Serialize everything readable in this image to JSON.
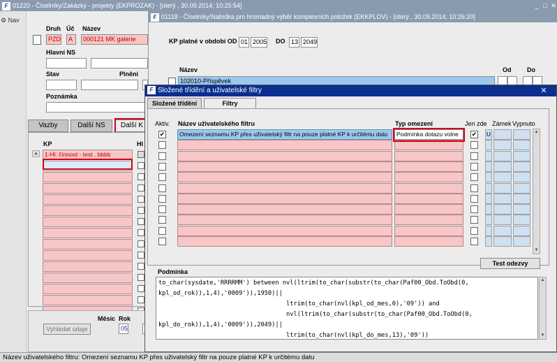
{
  "colors": {
    "title_active": "#0a2f8f",
    "title_inactive": "#8a9bb0",
    "pink": "#f7c6c6",
    "highlight_red": "#d4001a",
    "selected_row": "#9cc8f0"
  },
  "win1": {
    "title": "01220 - Číselníky/Zakázky - projekty (EKPROZAK) - [úterý , 30.09.2014; 10:25:54]",
    "nav": "Nav",
    "labels": {
      "druh": "Druh",
      "uc": "Úč",
      "nazev": "Název",
      "hlavni_ns": "Hlavní NS",
      "stav": "Stav",
      "plneni": "Plnění",
      "poznamka": "Poznámka",
      "kp": "KP",
      "hl": "Hl",
      "mesic": "Měsíc",
      "rok": "Rok"
    },
    "values": {
      "druh": "PZD",
      "uc": "A",
      "nazev": "000121 MK galerie",
      "mesic": "05"
    },
    "tabs": [
      "Vazby",
      "Další NS",
      "Další K"
    ],
    "kp_rows": [
      "1-Hl. činnost - test . bbbb",
      "",
      "",
      "",
      "",
      "",
      "",
      "",
      "",
      "",
      "",
      "",
      "",
      "",
      ""
    ],
    "button": "Vyhledat údaje"
  },
  "win2": {
    "title": "01118 - Číselníky/Nabídka pro hromadný výběr komplexních položek (EKKPLOV) - [úterý , 30.09.2014; 10:26:20]",
    "period_label": "KP platné v období OD",
    "od": [
      "01",
      "2005"
    ],
    "do_label": "DO",
    "do": [
      "13",
      "2049"
    ],
    "nazev_header": "Název",
    "od_header": "Od",
    "do_header": "Do",
    "first_row": "102010-Příspěvek"
  },
  "win3": {
    "title": "Složené třídění a uživatelské filtry",
    "tabs": [
      "Složené třídění",
      "Filtry"
    ],
    "headers": {
      "aktiv": "Aktiv.",
      "nazev": "Název uživatelského filtru",
      "typ": "Typ omezení",
      "jen_zde": "Jen zde",
      "zamek": "Zámek",
      "vypnuto": "Vypnuto"
    },
    "rows": [
      {
        "active": "✔",
        "name": "Omezení seznamu KP přes uživatelský filtr na pouze platné KP k určitému datu",
        "type": "Podmínka dotazu volne",
        "jen_zde": "✔",
        "zamek": "U",
        "vypnuto": ""
      },
      {
        "active": "",
        "name": "",
        "type": "",
        "jen_zde": "",
        "zamek": "",
        "vypnuto": ""
      },
      {
        "active": "",
        "name": "",
        "type": "",
        "jen_zde": "",
        "zamek": "",
        "vypnuto": ""
      },
      {
        "active": "",
        "name": "",
        "type": "",
        "jen_zde": "",
        "zamek": "",
        "vypnuto": ""
      },
      {
        "active": "",
        "name": "",
        "type": "",
        "jen_zde": "",
        "zamek": "",
        "vypnuto": ""
      },
      {
        "active": "",
        "name": "",
        "type": "",
        "jen_zde": "",
        "zamek": "",
        "vypnuto": ""
      },
      {
        "active": "",
        "name": "",
        "type": "",
        "jen_zde": "",
        "zamek": "",
        "vypnuto": ""
      },
      {
        "active": "",
        "name": "",
        "type": "",
        "jen_zde": "",
        "zamek": "",
        "vypnuto": ""
      },
      {
        "active": "",
        "name": "",
        "type": "",
        "jen_zde": "",
        "zamek": "",
        "vypnuto": ""
      },
      {
        "active": "",
        "name": "",
        "type": "",
        "jen_zde": "",
        "zamek": "",
        "vypnuto": ""
      },
      {
        "active": "",
        "name": "",
        "type": "",
        "jen_zde": "",
        "zamek": "",
        "vypnuto": ""
      }
    ],
    "test_button": "Test odezvy",
    "podminka_label": "Podmínka",
    "podminka_lines": [
      "to_char(sysdate,'RRRRMM') between nvl(ltrim(to_char(substr(to_char(Paf00_Obd.ToObd(0,",
      "kpl_od_rok)),1,4),'0009')),1950)||",
      "                                   ltrim(to_char(nvl(kpl_od_mes,0),'09')) and",
      "                                   nvl(ltrim(to_char(substr(to_char(Paf00_Obd.ToObd(0,",
      "kpl_do_rok)),1,4),'0009')),2049)||",
      "                                   ltrim(to_char(nvl(kpl_do_mes,13),'09'))"
    ]
  },
  "status_bar": "Název uživatelského filtru: Omezení seznamu KP přes uživatelský filtr na pouze platné KP k určitému datu"
}
